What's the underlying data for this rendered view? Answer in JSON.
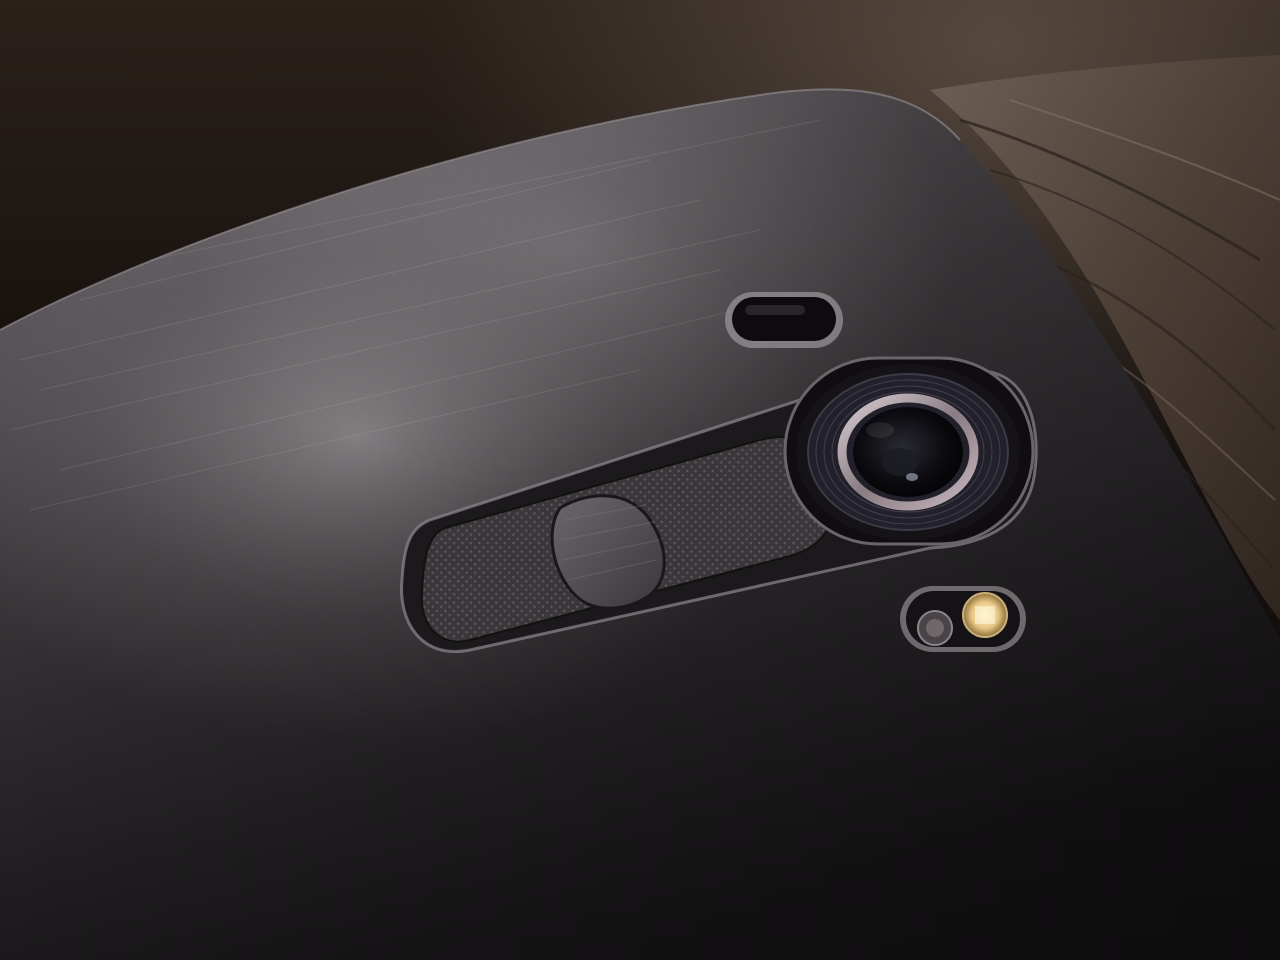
{
  "scene": {
    "subject": "phone-rear-closeup",
    "colors": {
      "background_top": "#2b211b",
      "background_mid": "#14100d",
      "wood_light": "#6d5f55",
      "wood_dark": "#3a2e27",
      "body_light": "#a9a4a8",
      "body_mid": "#5c575c",
      "body_dark": "#2f2b2f",
      "module_dark": "#1e1b1e",
      "lens_ring": "#b8a8b0",
      "flash_amber": "#e8c785"
    },
    "elements": {
      "phone_body": "brushed-metal-back-panel",
      "laser_autofocus": "sensor-slot",
      "camera_lens": "rear-camera",
      "rear_key": "textured-volume-rocker",
      "power_button": "center-power-button",
      "flash": "dual-tone-led-flash"
    }
  }
}
